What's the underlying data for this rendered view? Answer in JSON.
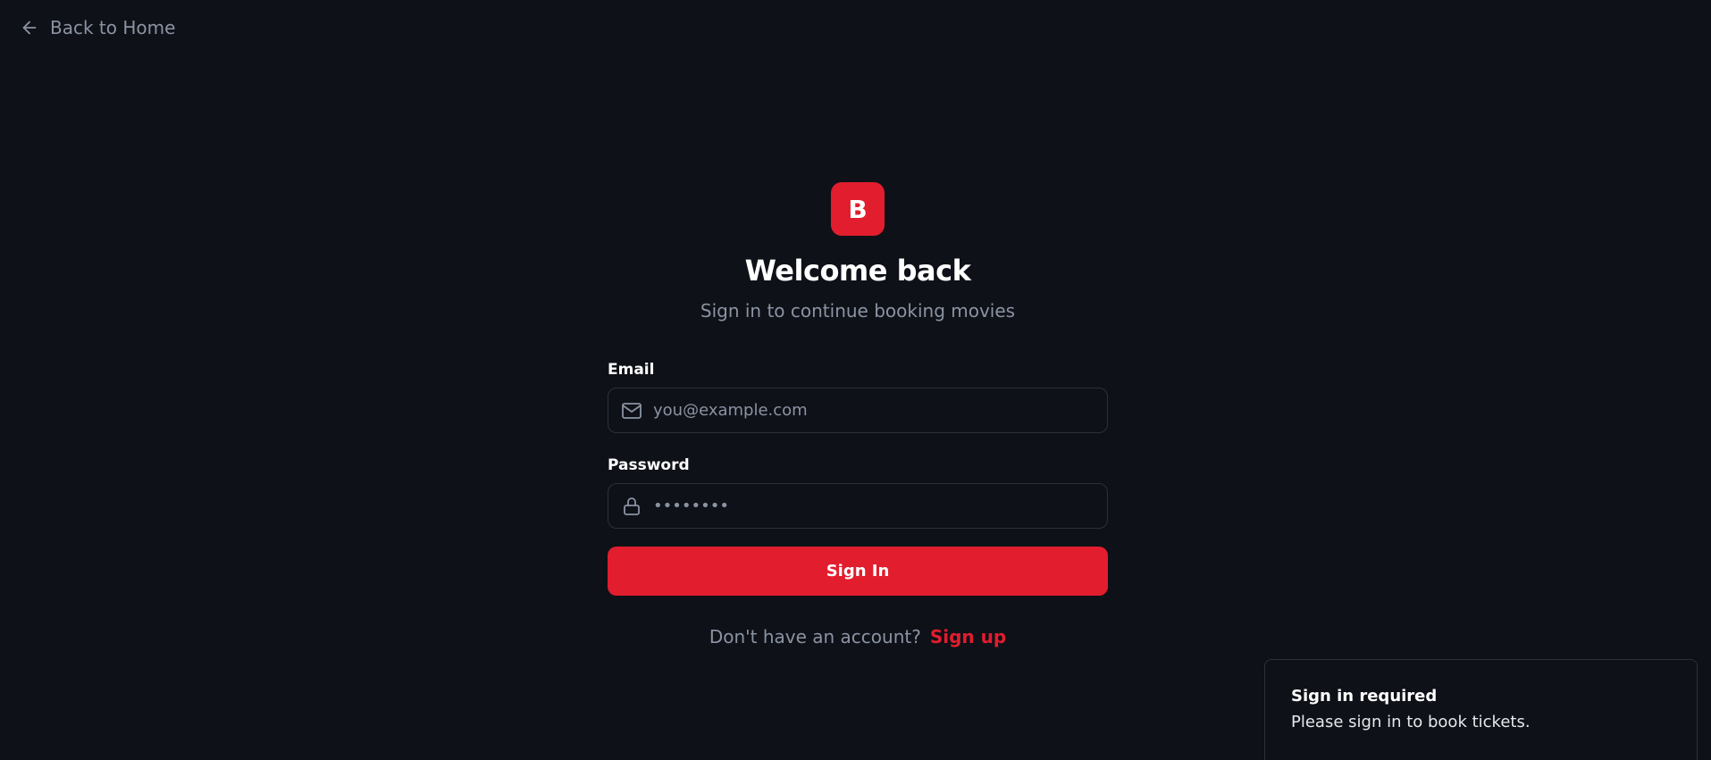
{
  "nav": {
    "back_label": "Back to Home"
  },
  "brand": {
    "logo_letter": "B",
    "accent_color": "#e11d2e"
  },
  "auth": {
    "title": "Welcome back",
    "subtitle": "Sign in to continue booking movies",
    "email": {
      "label": "Email",
      "placeholder": "you@example.com",
      "value": ""
    },
    "password": {
      "label": "Password",
      "placeholder": "••••••••",
      "value": ""
    },
    "submit_label": "Sign In",
    "signup_prompt": "Don't have an account?",
    "signup_link": "Sign up"
  },
  "toast": {
    "title": "Sign in required",
    "message": "Please sign in to book tickets."
  },
  "icons": {
    "back": "arrow-left-icon",
    "email": "mail-icon",
    "password": "lock-icon"
  }
}
